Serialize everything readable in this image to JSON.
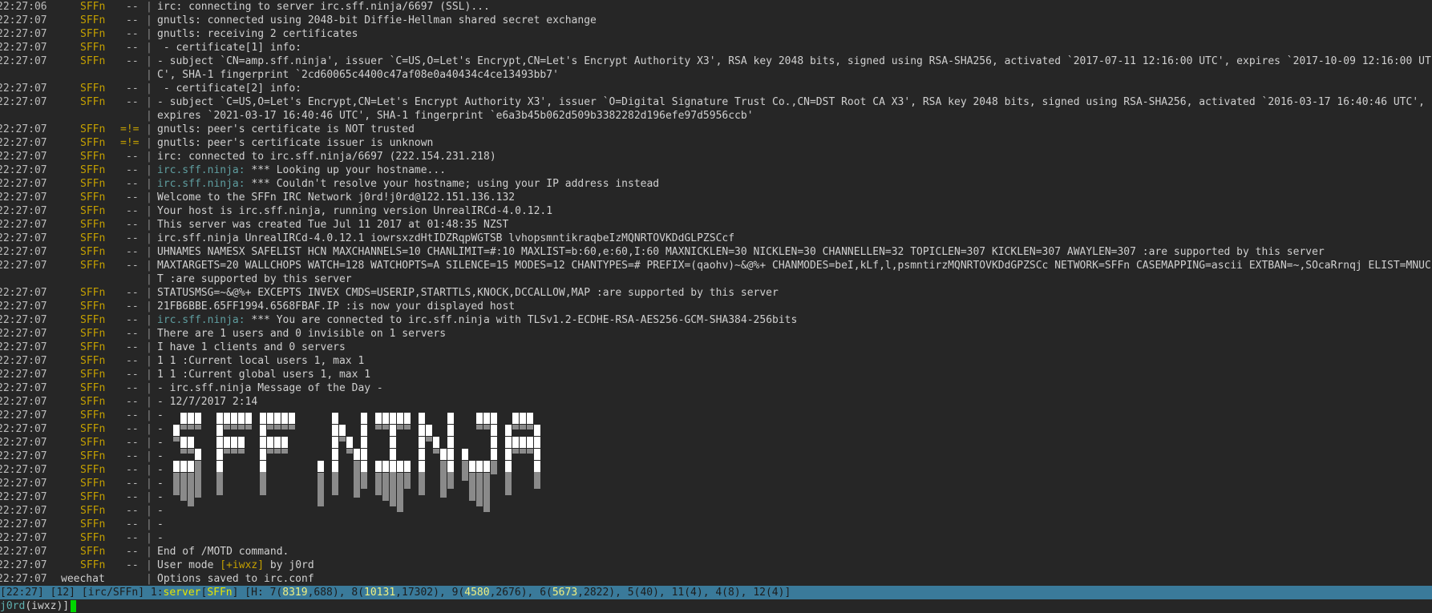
{
  "log": {
    "lines": [
      {
        "ts": "22:27:06",
        "nick": "SFFn",
        "prefix": "--",
        "text": "irc: connecting to server irc.sff.ninja/6697 (SSL)...",
        "wrap": false,
        "hl": "none"
      },
      {
        "ts": "22:27:07",
        "nick": "SFFn",
        "prefix": "--",
        "text": "gnutls: connected using 2048-bit Diffie-Hellman shared secret exchange",
        "wrap": false,
        "hl": "none"
      },
      {
        "ts": "22:27:07",
        "nick": "SFFn",
        "prefix": "--",
        "text": "gnutls: receiving 2 certificates",
        "wrap": false,
        "hl": "none"
      },
      {
        "ts": "22:27:07",
        "nick": "SFFn",
        "prefix": "--",
        "text": " - certificate[1] info:",
        "wrap": false,
        "hl": "none"
      },
      {
        "ts": "22:27:07",
        "nick": "SFFn",
        "prefix": "--",
        "text": "   - subject `CN=amp.sff.ninja', issuer `C=US,O=Let's Encrypt,CN=Let's Encrypt Authority X3', RSA key 2048 bits, signed using RSA-SHA256, activated `2017-07-11 12:16:00 UTC', expires `2017-10-09 12:16:00 UTC', SHA-1 fingerprint `2cd60065c4400c47af08e0a40434c4ce13493bb7'",
        "wrap": true,
        "hl": "none"
      },
      {
        "ts": "22:27:07",
        "nick": "SFFn",
        "prefix": "--",
        "text": " - certificate[2] info:",
        "wrap": false,
        "hl": "none"
      },
      {
        "ts": "22:27:07",
        "nick": "SFFn",
        "prefix": "--",
        "text": "   - subject `C=US,O=Let's Encrypt,CN=Let's Encrypt Authority X3', issuer `O=Digital Signature Trust Co.,CN=DST Root CA X3', RSA key 2048 bits, signed using RSA-SHA256, activated `2016-03-17 16:40:46 UTC', expires `2021-03-17 16:40:46 UTC', SHA-1 fingerprint `e6a3b45b062d509b3382282d196efe97d5956ccb'",
        "wrap": true,
        "hl": "none"
      },
      {
        "ts": "22:27:07",
        "nick": "SFFn",
        "prefix": "=!=",
        "text": "gnutls: peer's certificate is NOT trusted",
        "wrap": false,
        "hl": "none",
        "err": true
      },
      {
        "ts": "22:27:07",
        "nick": "SFFn",
        "prefix": "=!=",
        "text": "gnutls: peer's certificate issuer is unknown",
        "wrap": false,
        "hl": "none",
        "err": true
      },
      {
        "ts": "22:27:07",
        "nick": "SFFn",
        "prefix": "--",
        "text": "irc: connected to irc.sff.ninja/6697 (222.154.231.218)",
        "wrap": false,
        "hl": "none"
      },
      {
        "ts": "22:27:07",
        "nick": "SFFn",
        "prefix": "--",
        "host": "irc.sff.ninja:",
        "text": " *** Looking up your hostname...",
        "wrap": false,
        "hl": "host"
      },
      {
        "ts": "22:27:07",
        "nick": "SFFn",
        "prefix": "--",
        "host": "irc.sff.ninja:",
        "text": " *** Couldn't resolve your hostname; using your IP address instead",
        "wrap": false,
        "hl": "host"
      },
      {
        "ts": "22:27:07",
        "nick": "SFFn",
        "prefix": "--",
        "text": "Welcome to the SFFn IRC Network j0rd!j0rd@122.151.136.132",
        "wrap": false,
        "hl": "none"
      },
      {
        "ts": "22:27:07",
        "nick": "SFFn",
        "prefix": "--",
        "text": "Your host is irc.sff.ninja, running version UnrealIRCd-4.0.12.1",
        "wrap": false,
        "hl": "none"
      },
      {
        "ts": "22:27:07",
        "nick": "SFFn",
        "prefix": "--",
        "text": "This server was created Tue Jul 11 2017 at 01:48:35 NZST",
        "wrap": false,
        "hl": "none"
      },
      {
        "ts": "22:27:07",
        "nick": "SFFn",
        "prefix": "--",
        "text": "irc.sff.ninja UnrealIRCd-4.0.12.1 iowrsxzdHtIDZRqpWGTSB lvhopsmntikraqbeIzMQNRTOVKDdGLPZSCcf",
        "wrap": false,
        "hl": "none"
      },
      {
        "ts": "22:27:07",
        "nick": "SFFn",
        "prefix": "--",
        "text": "UHNAMES NAMESX SAFELIST HCN MAXCHANNELS=10 CHANLIMIT=#:10 MAXLIST=b:60,e:60,I:60 MAXNICKLEN=30 NICKLEN=30 CHANNELLEN=32 TOPICLEN=307 KICKLEN=307 AWAYLEN=307 :are supported by this server",
        "wrap": false,
        "hl": "none"
      },
      {
        "ts": "22:27:07",
        "nick": "SFFn",
        "prefix": "--",
        "text": "MAXTARGETS=20 WALLCHOPS WATCH=128 WATCHOPTS=A SILENCE=15 MODES=12 CHANTYPES=# PREFIX=(qaohv)~&@%+ CHANMODES=beI,kLf,l,psmntirzMQNRTOVKDdGPZSCc NETWORK=SFFn CASEMAPPING=ascii EXTBAN=~,SOcaRrnqj ELIST=MNUCT :are supported by this server",
        "wrap": true,
        "hl": "none"
      },
      {
        "ts": "22:27:07",
        "nick": "SFFn",
        "prefix": "--",
        "text": "STATUSMSG=~&@%+ EXCEPTS INVEX CMDS=USERIP,STARTTLS,KNOCK,DCCALLOW,MAP :are supported by this server",
        "wrap": false,
        "hl": "none"
      },
      {
        "ts": "22:27:07",
        "nick": "SFFn",
        "prefix": "--",
        "text": "21FB6BBE.65FF1994.6568FBAF.IP :is now your displayed host",
        "wrap": false,
        "hl": "none"
      },
      {
        "ts": "22:27:07",
        "nick": "SFFn",
        "prefix": "--",
        "host": "irc.sff.ninja:",
        "text": " *** You are connected to irc.sff.ninja with TLSv1.2-ECDHE-RSA-AES256-GCM-SHA384-256bits",
        "wrap": false,
        "hl": "host"
      },
      {
        "ts": "22:27:07",
        "nick": "SFFn",
        "prefix": "--",
        "text": "There are 1 users and 0 invisible on 1 servers",
        "wrap": false,
        "hl": "none"
      },
      {
        "ts": "22:27:07",
        "nick": "SFFn",
        "prefix": "--",
        "text": "I have 1 clients and 0 servers",
        "wrap": false,
        "hl": "none"
      },
      {
        "ts": "22:27:07",
        "nick": "SFFn",
        "prefix": "--",
        "text": "1 1 :Current local users 1, max 1",
        "wrap": false,
        "hl": "none"
      },
      {
        "ts": "22:27:07",
        "nick": "SFFn",
        "prefix": "--",
        "text": "1 1 :Current global users 1, max 1",
        "wrap": false,
        "hl": "none"
      },
      {
        "ts": "22:27:07",
        "nick": "SFFn",
        "prefix": "--",
        "text": "- irc.sff.ninja Message of the Day -",
        "wrap": false,
        "hl": "none"
      },
      {
        "ts": "22:27:07",
        "nick": "SFFn",
        "prefix": "--",
        "text": "- 12/7/2017 2:14",
        "wrap": false,
        "hl": "none"
      },
      {
        "ts": "22:27:07",
        "nick": "SFFn",
        "prefix": "--",
        "text": "-",
        "wrap": false,
        "hl": "none"
      },
      {
        "ts": "22:27:07",
        "nick": "SFFn",
        "prefix": "--",
        "text": "-",
        "wrap": false,
        "hl": "none"
      },
      {
        "ts": "22:27:07",
        "nick": "SFFn",
        "prefix": "--",
        "text": "-",
        "wrap": false,
        "hl": "none"
      },
      {
        "ts": "22:27:07",
        "nick": "SFFn",
        "prefix": "--",
        "text": "-",
        "wrap": false,
        "hl": "none"
      },
      {
        "ts": "22:27:07",
        "nick": "SFFn",
        "prefix": "--",
        "text": "-",
        "wrap": false,
        "hl": "none"
      },
      {
        "ts": "22:27:07",
        "nick": "SFFn",
        "prefix": "--",
        "text": "-",
        "wrap": false,
        "hl": "none"
      },
      {
        "ts": "22:27:07",
        "nick": "SFFn",
        "prefix": "--",
        "text": "-",
        "wrap": false,
        "hl": "none"
      },
      {
        "ts": "22:27:07",
        "nick": "SFFn",
        "prefix": "--",
        "text": "-",
        "wrap": false,
        "hl": "none"
      },
      {
        "ts": "22:27:07",
        "nick": "SFFn",
        "prefix": "--",
        "text": "-",
        "wrap": false,
        "hl": "none"
      },
      {
        "ts": "22:27:07",
        "nick": "SFFn",
        "prefix": "--",
        "text": "-",
        "wrap": false,
        "hl": "none"
      },
      {
        "ts": "22:27:07",
        "nick": "SFFn",
        "prefix": "--",
        "text": "End of /MOTD command.",
        "wrap": false,
        "hl": "none"
      },
      {
        "ts": "22:27:07",
        "nick": "SFFn",
        "prefix": "--",
        "text": "User mode [+iwxz] by j0rd",
        "wrap": false,
        "hl": "none"
      },
      {
        "ts": "22:27:07",
        "nick": "weechat",
        "prefix": "",
        "text": "Options saved to irc.conf",
        "wrap": false,
        "hl": "none",
        "wee": true
      }
    ]
  },
  "motd_art": {
    "text": "SFF.NINJA",
    "fg": "#ffffff",
    "shadow": "#8a8a8a"
  },
  "statusbar": {
    "time": "[22:27]",
    "buffer_count": "[12]",
    "buffer_name": "[irc/SFFn]",
    "current": "1:server[SFFn]",
    "hotlist": "[H: 7(8319,688), 8(10131,17302), 9(4580,2676), 6(5673,2822), 5(40), 11(4), 4(8), 12(4)]"
  },
  "input": {
    "nick": "j0rd",
    "modes": "iwxz"
  },
  "colors": {
    "background": "#262626",
    "statusbar": "#3a7a9a",
    "nick": "#c4a000",
    "host": "#5f9ea0",
    "cursor": "#00d700"
  }
}
